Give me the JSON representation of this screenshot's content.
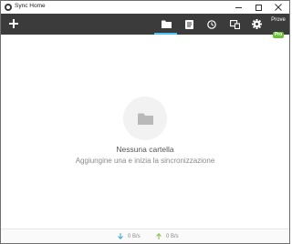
{
  "window": {
    "title": "Sync Home"
  },
  "toolbar": {
    "add_icon": "plus-icon",
    "buttons": [
      {
        "name": "folders",
        "icon": "folder-icon",
        "active": true
      },
      {
        "name": "notes",
        "icon": "document-icon",
        "active": false
      },
      {
        "name": "history",
        "icon": "clock-icon",
        "active": false
      },
      {
        "name": "devices",
        "icon": "devices-icon",
        "active": false
      },
      {
        "name": "settings",
        "icon": "gear-icon",
        "active": false
      }
    ],
    "trial_label": "Prove",
    "pro_badge": "Pro"
  },
  "main": {
    "empty_icon": "folder-icon",
    "empty_title": "Nessuna cartella",
    "empty_subtitle": "Aggiungine una e inizia la sincronizzazione"
  },
  "status": {
    "download_rate": "0 B/s",
    "upload_rate": "0 B/s"
  },
  "colors": {
    "toolbar_bg": "#3b3b3b",
    "active_indicator": "#4fc3f7",
    "pro_badge": "#6cbf3a",
    "download_arrow": "#4fa8d8",
    "upload_arrow": "#8bc34a"
  }
}
